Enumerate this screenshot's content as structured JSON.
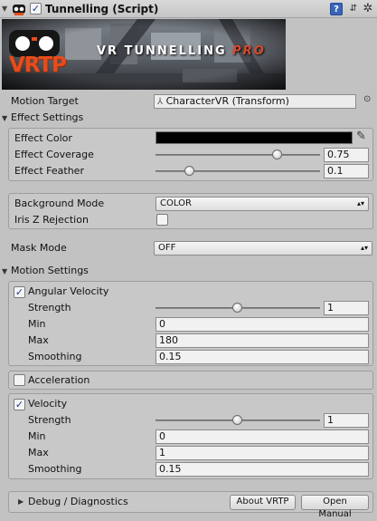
{
  "header": {
    "enabled": true,
    "title": "Tunnelling (Script)",
    "icons": [
      "script-icon",
      "help-icon",
      "preset-icon",
      "gear-icon"
    ]
  },
  "banner": {
    "logo": "VRTP",
    "title_main": "VR TUNNELLING ",
    "title_accent": "PRO"
  },
  "motion_target": {
    "label": "Motion Target",
    "value": "CharacterVR (Transform)"
  },
  "effect_settings": {
    "header": "Effect Settings",
    "color_label": "Effect Color",
    "color_value": "#000000",
    "coverage_label": "Effect Coverage",
    "coverage_value": "0.75",
    "feather_label": "Effect Feather",
    "feather_value": "0.1"
  },
  "background": {
    "mode_label": "Background Mode",
    "mode_value": "COLOR",
    "iris_label": "Iris Z Rejection",
    "iris_checked": false
  },
  "mask": {
    "label": "Mask Mode",
    "value": "OFF"
  },
  "motion_settings": {
    "header": "Motion Settings",
    "angular": {
      "label": "Angular Velocity",
      "checked": true,
      "strength_label": "Strength",
      "strength_value": "1",
      "min_label": "Min",
      "min_value": "0",
      "max_label": "Max",
      "max_value": "180",
      "smoothing_label": "Smoothing",
      "smoothing_value": "0.15"
    },
    "acceleration": {
      "label": "Acceleration",
      "checked": false
    },
    "velocity": {
      "label": "Velocity",
      "checked": true,
      "strength_label": "Strength",
      "strength_value": "1",
      "min_label": "Min",
      "min_value": "0",
      "max_label": "Max",
      "max_value": "1",
      "smoothing_label": "Smoothing",
      "smoothing_value": "0.15"
    }
  },
  "debug": {
    "label": "Debug / Diagnostics",
    "about_button": "About VRTP",
    "manual_button": "Open Manual"
  }
}
